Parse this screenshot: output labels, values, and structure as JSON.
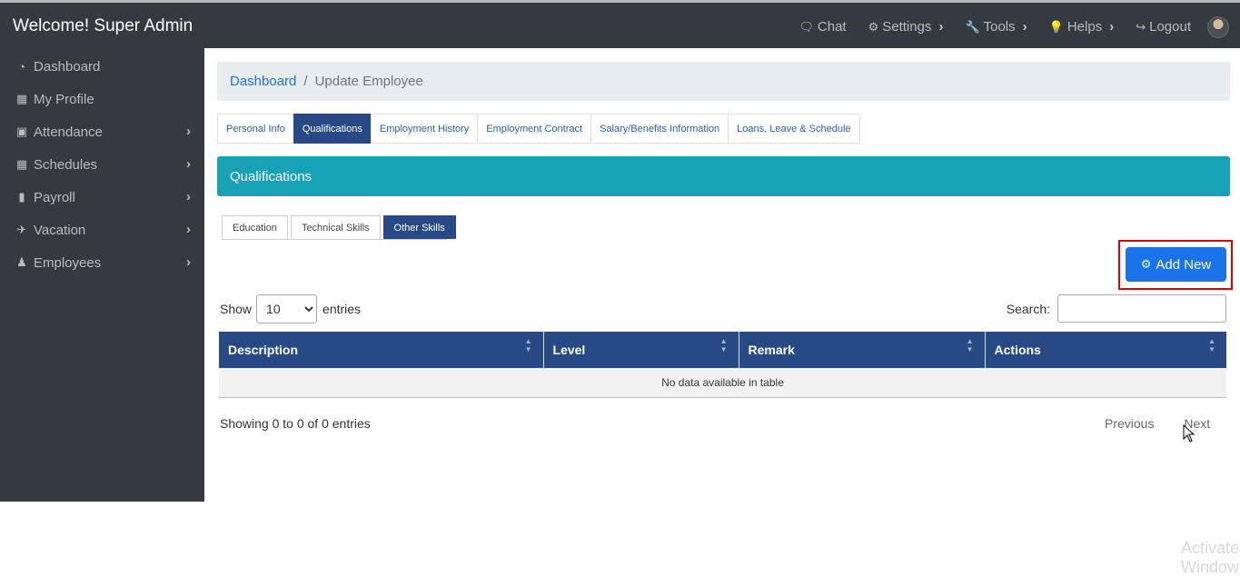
{
  "header": {
    "brand": "Welcome! Super Admin",
    "nav": [
      {
        "icon": "chat-icon",
        "label": "Chat",
        "chevron": false
      },
      {
        "icon": "settings-gears-icon",
        "label": "Settings",
        "chevron": true
      },
      {
        "icon": "wrench-icon",
        "label": "Tools",
        "chevron": true
      },
      {
        "icon": "lightbulb-icon",
        "label": "Helps",
        "chevron": true
      },
      {
        "icon": "logout-icon",
        "label": "Logout",
        "chevron": false
      }
    ]
  },
  "sidebar": {
    "items": [
      {
        "icon": "dashboard-icon",
        "label": "Dashboard",
        "chevron": false
      },
      {
        "icon": "profile-card-icon",
        "label": "My Profile",
        "chevron": false
      },
      {
        "icon": "calendar-icon",
        "label": "Attendance",
        "chevron": true
      },
      {
        "icon": "calendar-grid-icon",
        "label": "Schedules",
        "chevron": true
      },
      {
        "icon": "file-icon",
        "label": "Payroll",
        "chevron": true
      },
      {
        "icon": "plane-icon",
        "label": "Vacation",
        "chevron": true
      },
      {
        "icon": "users-icon",
        "label": "Employees",
        "chevron": true
      }
    ]
  },
  "breadcrumb": {
    "link": "Dashboard",
    "separator": "/",
    "current": "Update Employee"
  },
  "tabs": [
    {
      "label": "Personal Info",
      "active": false
    },
    {
      "label": "Qualifications",
      "active": true
    },
    {
      "label": "Employment History",
      "active": false
    },
    {
      "label": "Employment Contract",
      "active": false
    },
    {
      "label": "Salary/Benefits Information",
      "active": false
    },
    {
      "label": "Loans, Leave & Schedule",
      "active": false
    }
  ],
  "section_title": "Qualifications",
  "subtabs": [
    {
      "label": "Education",
      "active": false
    },
    {
      "label": "Technical Skills",
      "active": false
    },
    {
      "label": "Other Skills",
      "active": true
    }
  ],
  "add_button": {
    "label": "Add New",
    "icon": "gears-icon"
  },
  "table_controls": {
    "show_label": "Show",
    "entries_label": "entries",
    "page_size": "10",
    "page_size_options": [
      "10"
    ],
    "search_label": "Search:",
    "search_value": ""
  },
  "table": {
    "columns": [
      "Description",
      "Level",
      "Remark",
      "Actions"
    ],
    "empty_message": "No data available in table"
  },
  "footer": {
    "info": "Showing 0 to 0 of 0 entries",
    "previous": "Previous",
    "next": "Next"
  },
  "watermark": "Activate Windows",
  "colors": {
    "topbar": "#343a40",
    "accent_blue": "#1a73e8",
    "navy": "#274a86",
    "teal": "#17a2b8",
    "highlight_red": "#e00000"
  }
}
